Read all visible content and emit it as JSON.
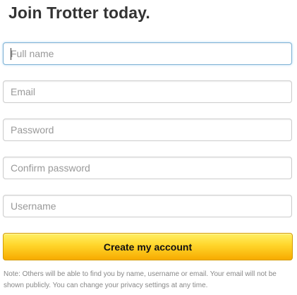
{
  "form": {
    "title": "Join Trotter today.",
    "fields": [
      {
        "name": "full-name",
        "placeholder": "Full name",
        "value": ""
      },
      {
        "name": "email",
        "placeholder": "Email",
        "value": ""
      },
      {
        "name": "password",
        "placeholder": "Password",
        "value": ""
      },
      {
        "name": "confirm-password",
        "placeholder": "Confirm password",
        "value": ""
      },
      {
        "name": "username",
        "placeholder": "Username",
        "value": ""
      }
    ],
    "submit_label": "Create my account",
    "note": "Note: Others will be able to find you by name, username or email. Your email will not be shown publicly. You can change your privacy settings at any time."
  },
  "colors": {
    "button_top": "#fff065",
    "button_bottom": "#f7ab00",
    "focus_border": "#7fb3d5"
  }
}
